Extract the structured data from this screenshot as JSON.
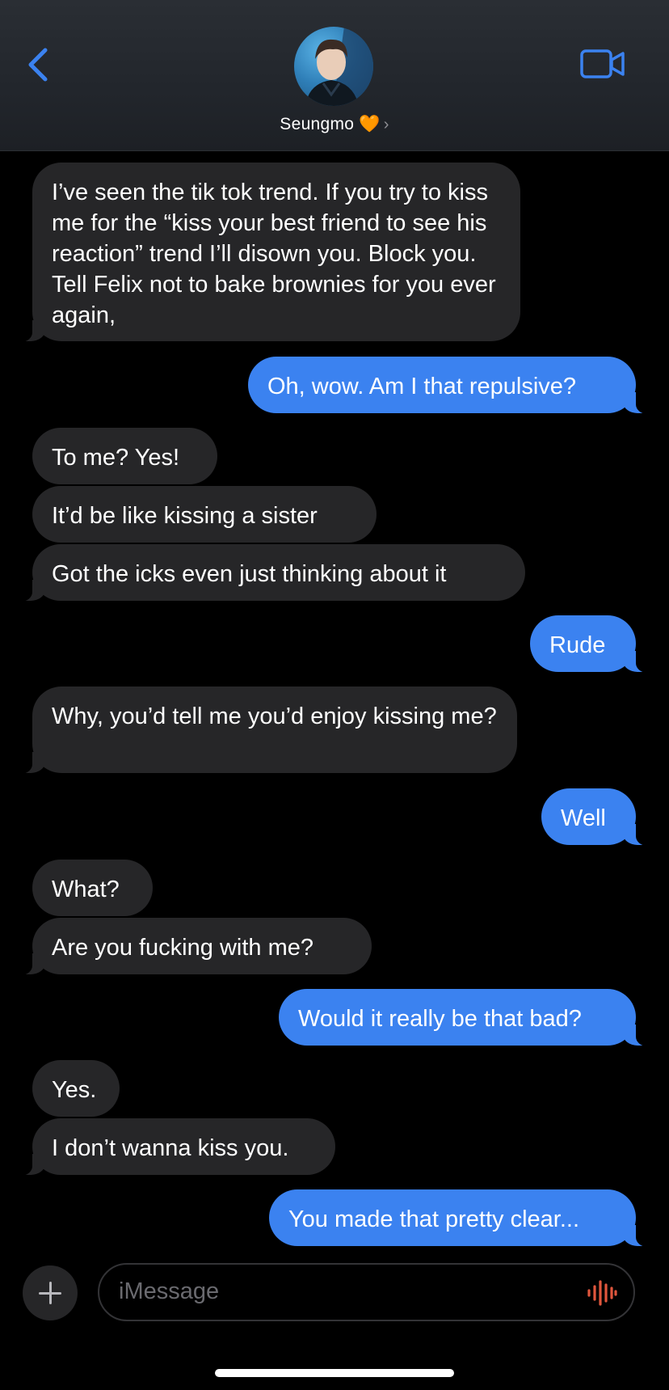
{
  "header": {
    "contact_name": "Seungmo",
    "contact_emoji": "🧡",
    "chevron": "›",
    "back_icon": "chevron-left-icon",
    "video_icon": "video-camera-icon",
    "accent": "#3b82f0"
  },
  "messages": [
    {
      "from": "them",
      "text": "I’ve seen the tik tok trend. If you try to kiss me for the “kiss your best friend to see his reaction” trend I’ll disown you. Block you. Tell Felix not to bake brownies for you ever again,"
    },
    {
      "from": "me",
      "text": "Oh, wow. Am I that repulsive?"
    },
    {
      "from": "them",
      "text": "To me? Yes!"
    },
    {
      "from": "them",
      "text": "It’d be like kissing a sister"
    },
    {
      "from": "them",
      "text": "Got the icks even just thinking about it"
    },
    {
      "from": "me",
      "text": "Rude"
    },
    {
      "from": "them",
      "text": "Why, you’d tell me you’d enjoy kissing me?"
    },
    {
      "from": "me",
      "text": "Well"
    },
    {
      "from": "them",
      "text": "What?"
    },
    {
      "from": "them",
      "text": "Are you fucking with me?"
    },
    {
      "from": "me",
      "text": "Would it really be that bad?"
    },
    {
      "from": "them",
      "text": "Yes."
    },
    {
      "from": "them",
      "text": "I don’t wanna kiss you."
    },
    {
      "from": "me",
      "text": "You made that pretty clear..."
    }
  ],
  "composer": {
    "placeholder": "iMessage",
    "plus_icon": "plus-icon",
    "audio_icon": "audio-waveform-icon"
  },
  "colors": {
    "sent_bubble": "#3b82f0",
    "received_bubble": "#262628",
    "background": "#000000"
  }
}
